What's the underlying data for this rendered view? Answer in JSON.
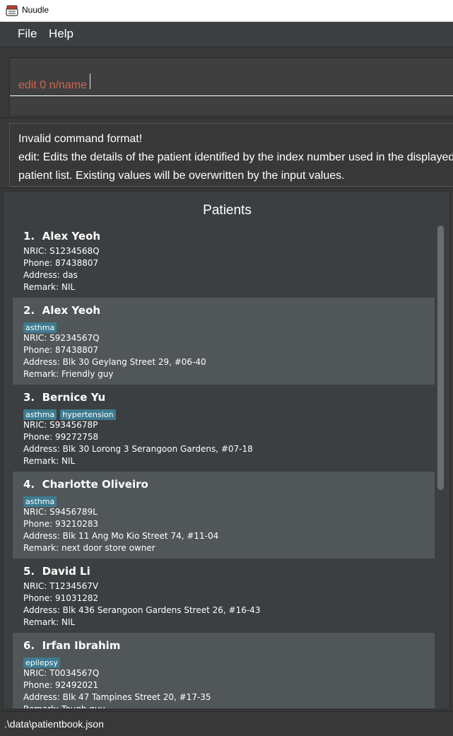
{
  "window": {
    "title": "Nuudle",
    "icon": "app-icon"
  },
  "menu": {
    "file": "File",
    "help": "Help"
  },
  "command": {
    "value": "edit 0 n/name"
  },
  "result": {
    "lines": [
      "Invalid command format!",
      "edit: Edits the details of the patient identified by the index number used in the displayed",
      "patient list. Existing values will be overwritten by the input values."
    ]
  },
  "patient_list": {
    "title": "Patients",
    "patients": [
      {
        "index": "1.",
        "name": "Alex Yeoh",
        "tags": [],
        "nric": "NRIC: S1234568Q",
        "phone": "Phone: 87438807",
        "address": "Address: das",
        "remark": "Remark: NIL"
      },
      {
        "index": "2.",
        "name": "Alex Yeoh",
        "tags": [
          "asthma"
        ],
        "nric": "NRIC: S9234567Q",
        "phone": "Phone: 87438807",
        "address": "Address: Blk 30 Geylang Street 29, #06-40",
        "remark": "Remark: Friendly guy"
      },
      {
        "index": "3.",
        "name": "Bernice Yu",
        "tags": [
          "asthma",
          "hypertension"
        ],
        "nric": "NRIC: S9345678P",
        "phone": "Phone: 99272758",
        "address": "Address: Blk 30 Lorong 3 Serangoon Gardens, #07-18",
        "remark": "Remark: NIL"
      },
      {
        "index": "4.",
        "name": "Charlotte Oliveiro",
        "tags": [
          "asthma"
        ],
        "nric": "NRIC: S9456789L",
        "phone": "Phone: 93210283",
        "address": "Address: Blk 11 Ang Mo Kio Street 74, #11-04",
        "remark": "Remark: next door store owner"
      },
      {
        "index": "5.",
        "name": "David Li",
        "tags": [],
        "nric": "NRIC: T1234567V",
        "phone": "Phone: 91031282",
        "address": "Address: Blk 436 Serangoon Gardens Street 26, #16-43",
        "remark": "Remark: NIL"
      },
      {
        "index": "6.",
        "name": "Irfan Ibrahim",
        "tags": [
          "epilepsy"
        ],
        "nric": "NRIC: T0034567Q",
        "phone": "Phone: 92492021",
        "address": "Address: Blk 47 Tampines Street 20, #17-35",
        "remark": "Remark: Tough guy"
      }
    ]
  },
  "status": {
    "file_path": ".\\data\\patientbook.json"
  },
  "colors": {
    "background": "#3c3f41",
    "tag": "#3e7b91",
    "command_text": "#d06651",
    "alt_row": "#515658"
  }
}
